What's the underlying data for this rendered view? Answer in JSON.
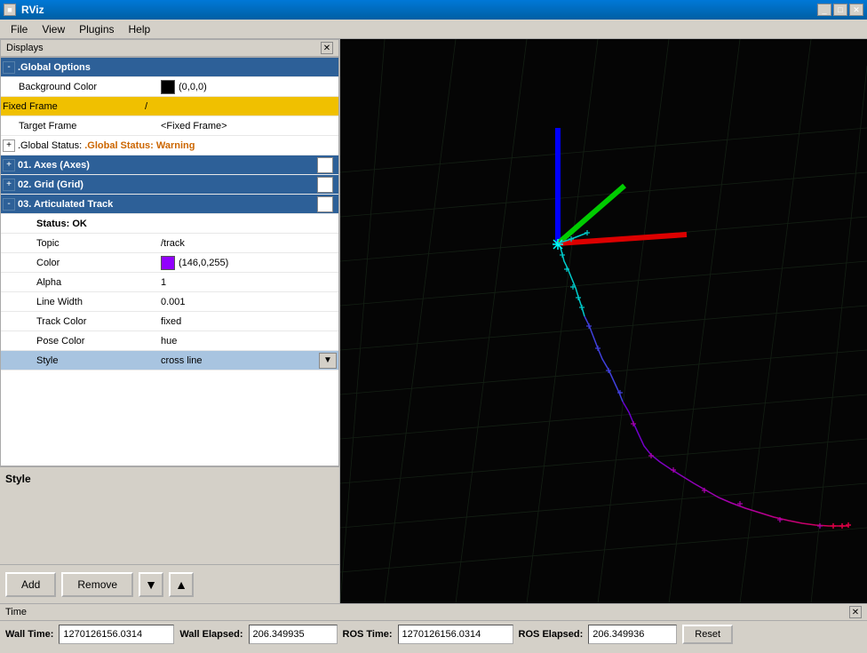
{
  "window": {
    "title": "RViz",
    "controls": [
      "_",
      "□",
      "✕"
    ]
  },
  "menu": {
    "items": [
      "File",
      "View",
      "Plugins",
      "Help"
    ]
  },
  "displays_panel": {
    "title": "Displays",
    "global_options": {
      "label": ".Global Options",
      "background_color": {
        "label": "Background Color",
        "value": "(0,0,0)"
      },
      "fixed_frame": {
        "label": "Fixed Frame",
        "value": "/"
      },
      "target_frame": {
        "label": "Target Frame",
        "value": "<Fixed Frame>"
      }
    },
    "global_status": {
      "label": ".Global Status: Warning"
    },
    "axes": {
      "label": "01. Axes (Axes)",
      "checked": true
    },
    "grid": {
      "label": "02. Grid (Grid)",
      "checked": true
    },
    "articulated_track": {
      "label": "03. Articulated Track",
      "checked": true,
      "status": "Status: OK",
      "topic": {
        "label": "Topic",
        "value": "/track"
      },
      "color": {
        "label": "Color",
        "value": "(146,0,255)"
      },
      "alpha": {
        "label": "Alpha",
        "value": "1"
      },
      "line_width": {
        "label": "Line Width",
        "value": "0.001"
      },
      "track_color": {
        "label": "Track Color",
        "value": "fixed"
      },
      "pose_color": {
        "label": "Pose Color",
        "value": "hue"
      },
      "style": {
        "label": "Style",
        "value": "cross line"
      }
    }
  },
  "style_panel": {
    "title": "Style"
  },
  "buttons": {
    "add": "Add",
    "remove": "Remove",
    "down_arrow": "▼",
    "up_arrow": "▲"
  },
  "time_bar": {
    "title": "Time",
    "wall_time_label": "Wall Time:",
    "wall_time_value": "1270126156.0314",
    "wall_elapsed_label": "Wall Elapsed:",
    "wall_elapsed_value": "206.349935",
    "ros_time_label": "ROS Time:",
    "ros_time_value": "1270126156.0314",
    "ros_elapsed_label": "ROS Elapsed:",
    "ros_elapsed_value": "206.349936",
    "reset_label": "Reset"
  }
}
